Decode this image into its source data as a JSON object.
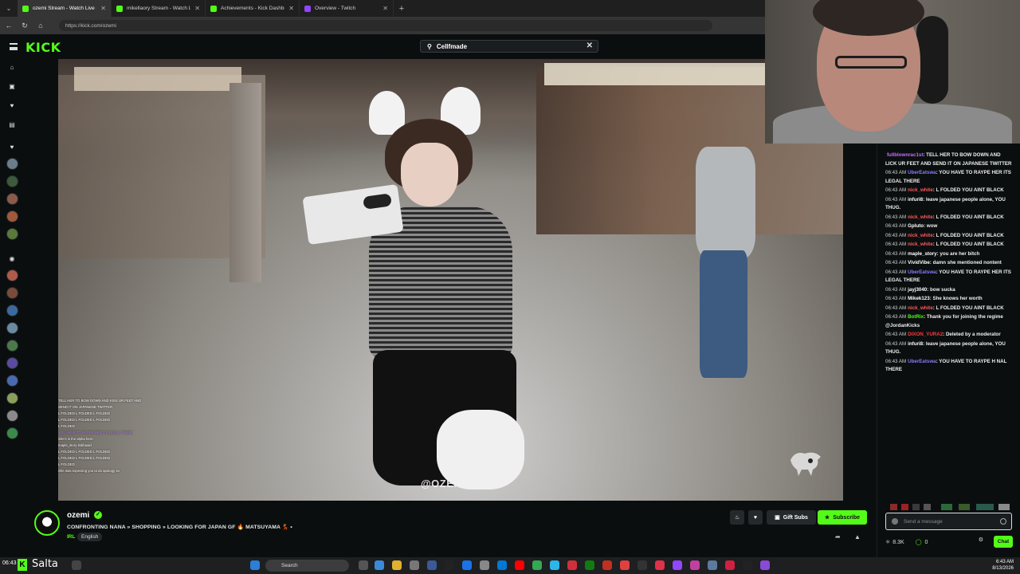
{
  "browser": {
    "tabs": [
      {
        "label": "ozemi Stream - Watch Live on",
        "active": true
      },
      {
        "label": "mikellaory Stream - Watch Li",
        "active": false
      },
      {
        "label": "Achievements - Kick Dashboard",
        "active": false
      },
      {
        "label": "Overview - Twitch",
        "active": false
      }
    ],
    "url": "https://kick.com/ozemi"
  },
  "kick": {
    "logo": "KICK",
    "search_value": "Cellfmade"
  },
  "video": {
    "watermark": "@OZEMIII",
    "overlay_chat": [
      {
        "user": "",
        "text": "TELL HER TO BOW DOWN AND KISS UR FEET AND"
      },
      {
        "user": "",
        "text": "SEND IT ON JAPANESE TWITTER"
      },
      {
        "user": "",
        "text": "L FOLDED  L FOLDED  L FOLDED"
      },
      {
        "user": "",
        "text": "L FOLDED  L FOLDED  L FOLDED"
      },
      {
        "user": "",
        "text": "L FOLDED"
      },
      {
        "user": "",
        "text": "YOU HAVE TO RAYPE HER ITS LEGAL THERE"
      },
      {
        "user": "",
        "text": "She's is the alpha here"
      },
      {
        "user": "",
        "text": "maple_story  itsbbaaid"
      },
      {
        "user": "",
        "text": "L FOLDED  L FOLDED  L FOLDED"
      },
      {
        "user": "",
        "text": "L FOLDED  L FOLDED  L FOLDED"
      },
      {
        "user": "",
        "text": "L FOLDED"
      },
      {
        "user": "",
        "text": "She was expecting you to do  apology so"
      }
    ]
  },
  "channel": {
    "name": "ozemi",
    "title": "CONFRONTING NANA » SHOPPING » LOOKING FOR JAPAN GF 🔥 MATSUYAMA 💃 •",
    "category": "IRL",
    "language": "English",
    "gift_label": "Gift Subs",
    "subscribe_label": "Subscribe"
  },
  "chat": {
    "messages": [
      {
        "ts": "",
        "user": "fullblownrac1st",
        "color": "#c070ff",
        "text": "TELL HER TO BOW DOWN AND LICK UR FEET AND SEND IT ON JAPANESE TWITTER"
      },
      {
        "ts": "06:43 AM",
        "user": "UberEatswa",
        "color": "#8a7cff",
        "text": "YOU HAVE TO RAYPE HER ITS LEGAL THERE"
      },
      {
        "ts": "06:43 AM",
        "user": "nick_white",
        "color": "#ff5a5a",
        "text": "L   FOLDED   YOU AINT BLACK"
      },
      {
        "ts": "06:43 AM",
        "user": "infuri8",
        "color": "#ffffff",
        "text": "leave japanese people alone, YOU THUG."
      },
      {
        "ts": "06:43 AM",
        "user": "nick_white",
        "color": "#ff5a5a",
        "text": "L   FOLDED   YOU AINT BLACK"
      },
      {
        "ts": "06:43 AM",
        "user": "Gpluto",
        "color": "#ffffff",
        "text": "wow"
      },
      {
        "ts": "06:43 AM",
        "user": "nick_white",
        "color": "#ff5a5a",
        "text": "L   FOLDED   YOU AINT BLACK"
      },
      {
        "ts": "06:43 AM",
        "user": "nick_white",
        "color": "#ff5a5a",
        "text": "L   FOLDED   YOU AINT BLACK"
      },
      {
        "ts": "06:43 AM",
        "user": "maple_story",
        "color": "#ffffff",
        "text": "you are her bitch"
      },
      {
        "ts": "06:43 AM",
        "user": "VividVibe",
        "color": "#ffffff",
        "text": "damn she mentioned nontent"
      },
      {
        "ts": "06:43 AM",
        "user": "UberEatswa",
        "color": "#8a7cff",
        "text": "YOU HAVE TO RAYPE HER ITS LEGAL THERE"
      },
      {
        "ts": "06:43 AM",
        "user": "jayj3040",
        "color": "#ffffff",
        "text": "bow sucka"
      },
      {
        "ts": "06:43 AM",
        "user": "Mikek123",
        "color": "#ffffff",
        "text": "She knows her worth"
      },
      {
        "ts": "06:43 AM",
        "user": "nick_white",
        "color": "#ff5a5a",
        "text": "L   FOLDED   YOU AINT BLACK"
      },
      {
        "ts": "06:43 AM",
        "user": "BotRix",
        "color": "#53fc18",
        "text": "Thank you for joining the regime @JordanKicks"
      },
      {
        "ts": "06:43 AM",
        "user": "DIXON_YURA2",
        "color": "#ff3b3b",
        "text": "Deleted by a moderator"
      },
      {
        "ts": "06:43 AM",
        "user": "infuri8",
        "color": "#ffffff",
        "text": "leave japanese people alone, YOU THUG."
      },
      {
        "ts": "06:43 AM",
        "user": "UberEatswa",
        "color": "#8a7cff",
        "text": "YOU HAVE TO RAYPE H   NAL THERE"
      }
    ],
    "input_placeholder": "Send a message",
    "viewers": "8.3K",
    "points": "0",
    "send_label": "Chat"
  },
  "taskbar": {
    "left_time": "06:43",
    "pinned_label": "Salta",
    "search_placeholder": "Search",
    "clock_time": "6:43 AM",
    "clock_date": "8/13/2026"
  },
  "colors": {
    "kick_green": "#53fc18",
    "bg": "#0b0e0f"
  }
}
